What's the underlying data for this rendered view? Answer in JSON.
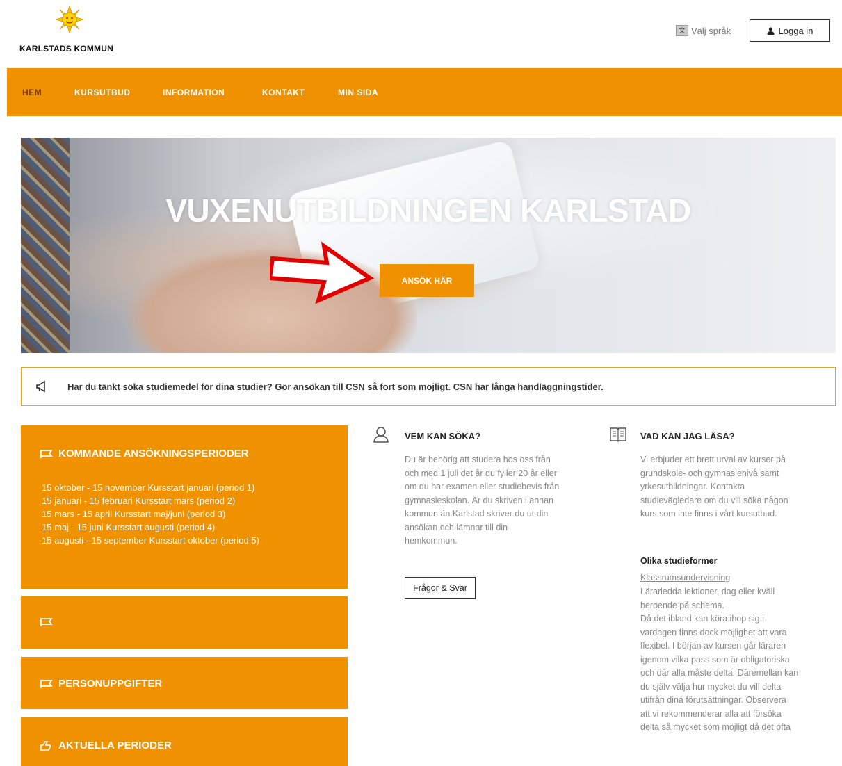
{
  "header": {
    "logo_text": "KARLSTADS KOMMUN",
    "language_label": "Välj språk",
    "login_label": "Logga in"
  },
  "nav": {
    "items": [
      "HEM",
      "KURSUTBUD",
      "INFORMATION",
      "KONTAKT",
      "MIN SIDA"
    ],
    "active": "HEM"
  },
  "hero": {
    "title": "VUXENUTBILDNINGEN KARLSTAD",
    "apply_label": "ANSÖK HÄR"
  },
  "notice": {
    "text": "Har du tänkt söka studiemedel för dina studier? Gör ansökan till CSN så fort som möjligt. CSN har långa handläggningstider."
  },
  "periods_box": {
    "title": "KOMMANDE ANSÖKNINGSPERIODER",
    "items": [
      "15 oktober - 15 november Kursstart januari (period 1)",
      "15 januari - 15 februari Kursstart mars (period 2)",
      "15 mars - 15 april Kursstart maj/juni (period 3)",
      "15 maj - 15 juni Kursstart augusti (period 4)",
      "15 augusti - 15 september Kursstart oktober (period 5)"
    ]
  },
  "empty_box": {
    "title": ""
  },
  "personal_box": {
    "title": "PERSONUPPGIFTER"
  },
  "current_box": {
    "title": "AKTUELLA PERIODER"
  },
  "who": {
    "title": "VEM KAN SÖKA?",
    "lines": [
      "Du är behörig att studera hos oss från",
      "och med 1 juli det år du fyller 20 år eller",
      "om du har examen eller studiebevis från",
      "gymnasieskolan. Är du skriven i annan",
      "kommun än Karlstad skriver du ut din",
      "ansökan och lämnar till din",
      "hemkommun."
    ],
    "faq_label": "Frågor & Svar"
  },
  "what": {
    "title": "VAD KAN JAG LÄSA?",
    "lines": [
      "Vi erbjuder ett brett urval av kurser på",
      "grundskole- och gymnasienivå samt",
      "yrkesutbildningar. Kontakta",
      "studievägledare om du vill söka någon",
      "kurs som inte finns i vårt kursutbud."
    ],
    "subtitle": "Olika studieformer",
    "link": "Klassrumsundervisning",
    "lines2": [
      "Lärarledda lektioner, dag eller kväll",
      "beroende på schema.",
      "Då det ibland kan köra ihop sig i",
      "vardagen finns dock möjlighet att vara",
      "flexibel. I början av kursen går läraren",
      "igenom vilka pass som är obligatoriska",
      "och där alla måste delta. Däremellan kan",
      "du själv välja hur mycket du vill delta",
      "utifrån dina förutsättningar. Observera",
      "att vi rekommenderar alla att försöka",
      "delta så mycket som möjligt då det ofta"
    ]
  }
}
